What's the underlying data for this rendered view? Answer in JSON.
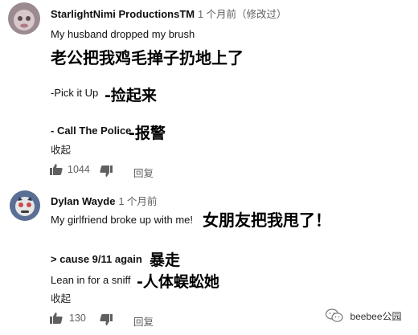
{
  "comment1": {
    "author": "StarlightNimi ProductionsTM",
    "time": "1 个月前（修改过）",
    "text_en": "My husband dropped my brush",
    "text_zh": "老公把我鸡毛掸子扔地上了",
    "line2_en": "-Pick it Up",
    "line2_zh": "-捡起来",
    "line3_en": "- Call The Police",
    "line3_zh": "-报警",
    "collapse": "收起",
    "likes": "1044",
    "reply": "回复",
    "avatar_colors": {
      "bg": "#9b8a8f",
      "accent": "#d8c8cc"
    }
  },
  "comment2": {
    "author": "Dylan Wayde",
    "time": "1 个月前",
    "text_en": "My girlfriend broke up with me!",
    "text_zh": "女朋友把我甩了！",
    "line2_en": "> cause 9/11 again",
    "line2_zh": "暴走",
    "line3_en": "Lean in for a sniff",
    "line3_zh": "-人体蜈蚣她",
    "collapse": "收起",
    "likes": "130",
    "reply": "回复",
    "avatar_colors": {
      "bg": "#5a6f96",
      "accent": "#c94b4b"
    }
  },
  "icons": {
    "like": "thumbs-up-icon",
    "dislike": "thumbs-down-icon",
    "watermark": "wechat-icon"
  },
  "watermark": {
    "text": "beebee公园"
  }
}
